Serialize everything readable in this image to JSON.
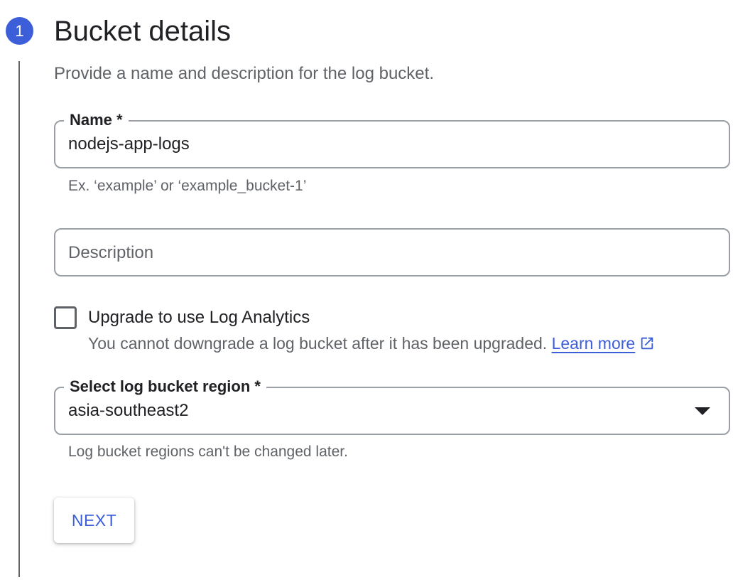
{
  "step": {
    "number": "1",
    "title": "Bucket details",
    "description": "Provide a name and description for the log bucket."
  },
  "name_field": {
    "label": "Name *",
    "value": "nodejs-app-logs",
    "hint": "Ex. ‘example’ or ‘example_bucket-1’"
  },
  "description_field": {
    "placeholder": "Description",
    "value": ""
  },
  "log_analytics": {
    "label": "Upgrade to use Log Analytics",
    "checked": false,
    "help_text": "You cannot downgrade a log bucket after it has been upgraded.",
    "learn_more": "Learn more",
    "learn_more_icon": "external-link-icon"
  },
  "region_select": {
    "label": "Select log bucket region *",
    "selected": "asia-southeast2",
    "hint": "Log bucket regions can't be changed later.",
    "icon": "dropdown-arrow-icon"
  },
  "next_button": {
    "label": "NEXT"
  },
  "colors": {
    "accent": "#3c5ed8",
    "border": "#9aa0a6",
    "text_primary": "#202124",
    "text_secondary": "#5f6368"
  }
}
